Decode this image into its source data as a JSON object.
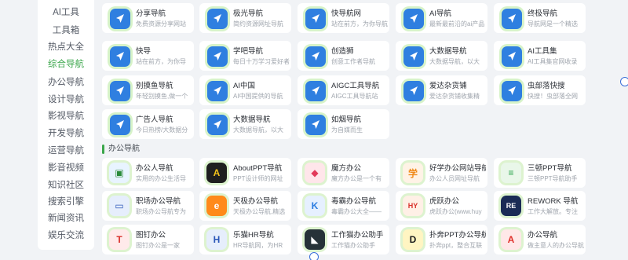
{
  "sidebar": {
    "items": [
      {
        "label": "AI工具"
      },
      {
        "label": "工具箱"
      },
      {
        "label": "热点大全"
      },
      {
        "label": "综合导航",
        "active": true
      },
      {
        "label": "办公导航"
      },
      {
        "label": "设计导航"
      },
      {
        "label": "影视导航"
      },
      {
        "label": "开发导航"
      },
      {
        "label": "运营导航"
      },
      {
        "label": "影音视频"
      },
      {
        "label": "知识社区"
      },
      {
        "label": "搜索引擎"
      },
      {
        "label": "新闻资讯"
      },
      {
        "label": "娱乐交流"
      }
    ]
  },
  "top_cards": [
    {
      "title": "分享导航",
      "desc": "免费资源分享网站"
    },
    {
      "title": "极光导航",
      "desc": "简约资源网址导航"
    },
    {
      "title": "快导航网",
      "desc": "站在前方，为你导航"
    },
    {
      "title": "AI导航",
      "desc": "最新最前沿的ai产品"
    },
    {
      "title": "终极导航",
      "desc": "导航网是一个精选"
    },
    {
      "title": "快导",
      "desc": "站在前方，为你导"
    },
    {
      "title": "学吧导航",
      "desc": "每日十万学习爱好者"
    },
    {
      "title": "创造狮",
      "desc": "创意工作者导航"
    },
    {
      "title": "大数据导航",
      "desc": "大数据导航，以大"
    },
    {
      "title": "AI工具集",
      "desc": "AI工具集官网收录"
    },
    {
      "title": "别摸鱼导航",
      "desc": "年轻别摸鱼,做一个"
    },
    {
      "title": "AI中国",
      "desc": "AI中国提供的导航"
    },
    {
      "title": "AIGC工具导航",
      "desc": "AIGC工具导航站"
    },
    {
      "title": "爱达杂货铺",
      "desc": "爱达杂货铺收集精"
    },
    {
      "title": "虫部落快搜",
      "desc": "快搜！虫部落全网"
    },
    {
      "title": "广告人导航",
      "desc": "今日热榜/大数据分"
    },
    {
      "title": "大数据导航",
      "desc": "大数据导航，以大"
    },
    {
      "title": "如烟导航",
      "desc": "为自媒而生"
    }
  ],
  "office_section": {
    "title": "办公导航"
  },
  "office_cards": [
    {
      "title": "办公人导航",
      "desc": "实用的办公生活导"
    },
    {
      "title": "AboutPPT导航",
      "desc": "PPT设计师的网址"
    },
    {
      "title": "魔方办公",
      "desc": "魔方办公是一个有"
    },
    {
      "title": "好学办公网站导航",
      "desc": "办公人员网址导航"
    },
    {
      "title": "三顿PPT导航",
      "desc": "三顿PPT导航助手"
    },
    {
      "title": "职场办公导航",
      "desc": "职场办公导航专为"
    },
    {
      "title": "天极办公导航",
      "desc": "天极办公导航,精选"
    },
    {
      "title": "毒霸办公导航",
      "desc": "毒霸办公大全——"
    },
    {
      "title": "虎跃办公",
      "desc": "虎跃办公(www.huy"
    },
    {
      "title": "REWORK 导航",
      "desc": "工作大解放。专注"
    },
    {
      "title": "图钉办公",
      "desc": "图钉办公是一家"
    },
    {
      "title": "乐猫HR导航",
      "desc": "HR导航网，为HR"
    },
    {
      "title": "工作猫办公助手",
      "desc": "工作猫办公助手"
    },
    {
      "title": "扑奔PPT办公导航",
      "desc": "扑奔ppt，整合互联"
    },
    {
      "title": "办公导航",
      "desc": "做主意人的办公导航"
    }
  ],
  "icons": {
    "nav": "navigation-arrow-icon",
    "office": [
      "monitor-icon",
      "aboutppt-icon",
      "cube-icon",
      "xue-icon",
      "sandun-icon",
      "laptop-icon",
      "e-letter-icon",
      "k-letter-icon",
      "hy-icon",
      "re-icon",
      "tuding-icon",
      "hr-icon",
      "cat-icon",
      "d-letter-icon",
      "office-a-icon"
    ]
  },
  "colors": {
    "accent": "#3aa64a",
    "nav_icon": "#2f7fe0"
  }
}
